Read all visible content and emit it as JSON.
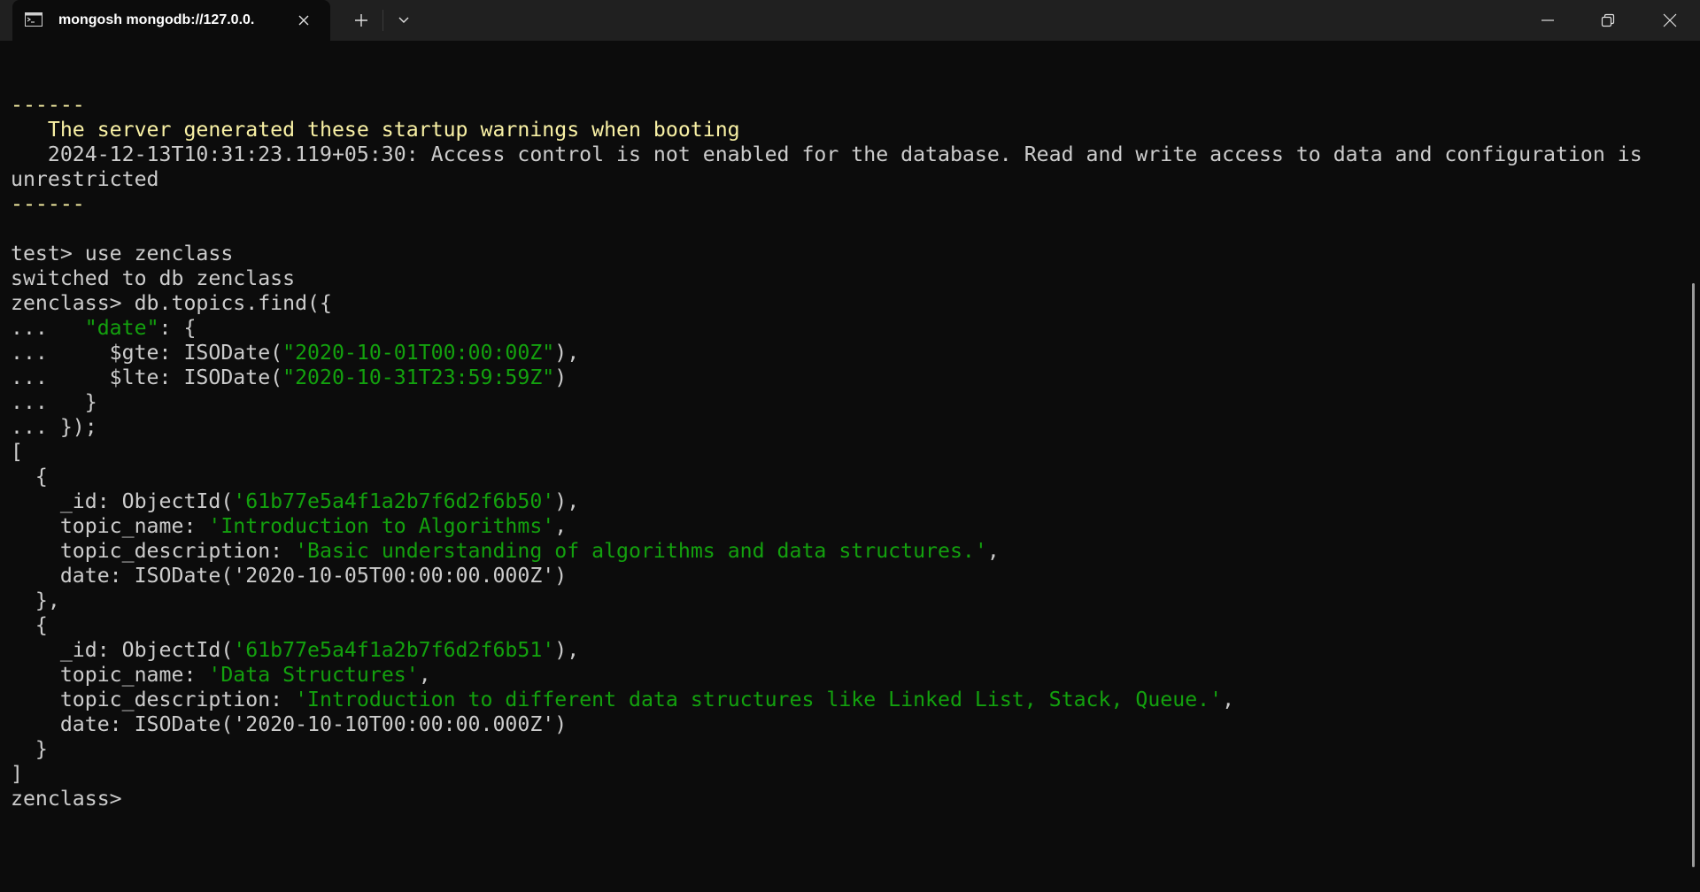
{
  "tab": {
    "title": "mongosh mongodb://127.0.0.",
    "icon": "terminal-icon",
    "close_icon": "close-icon"
  },
  "toolbar": {
    "new_tab_icon": "plus-icon",
    "dropdown_icon": "chevron-down-icon"
  },
  "window_controls": {
    "minimize_icon": "minimize-icon",
    "maximize_icon": "restore-icon",
    "close_icon": "close-icon"
  },
  "colors": {
    "background": "#0c0c0c",
    "titlebar": "#202020",
    "text": "#cccccc",
    "warning": "#f9f1a5",
    "string": "#13a10e"
  },
  "terminal": {
    "lines": [
      [],
      [
        {
          "t": "------",
          "c": "yellow"
        }
      ],
      [
        {
          "t": "   The server generated these startup warnings when booting",
          "c": "yellow"
        }
      ],
      [
        {
          "t": "   2024-12-13T10:31:23.119+05:30: Access control is not enabled for the database. Read and write access to data and configuration is",
          "c": "def"
        }
      ],
      [
        {
          "t": "unrestricted",
          "c": "def"
        }
      ],
      [
        {
          "t": "------",
          "c": "yellow"
        }
      ],
      [],
      [
        {
          "t": "test> use zenclass",
          "c": "def"
        }
      ],
      [
        {
          "t": "switched to db zenclass",
          "c": "def"
        }
      ],
      [
        {
          "t": "zenclass> db.topics.find({",
          "c": "def"
        }
      ],
      [
        {
          "t": "...   ",
          "c": "def"
        },
        {
          "t": "\"date\"",
          "c": "green"
        },
        {
          "t": ": {",
          "c": "def"
        }
      ],
      [
        {
          "t": "...     $gte: ISODate(",
          "c": "def"
        },
        {
          "t": "\"2020-10-01T00:00:00Z\"",
          "c": "green"
        },
        {
          "t": "),",
          "c": "def"
        }
      ],
      [
        {
          "t": "...     $lte: ISODate(",
          "c": "def"
        },
        {
          "t": "\"2020-10-31T23:59:59Z\"",
          "c": "green"
        },
        {
          "t": ")",
          "c": "def"
        }
      ],
      [
        {
          "t": "...   }",
          "c": "def"
        }
      ],
      [
        {
          "t": "... });",
          "c": "def"
        }
      ],
      [
        {
          "t": "[",
          "c": "def"
        }
      ],
      [
        {
          "t": "  {",
          "c": "def"
        }
      ],
      [
        {
          "t": "    _id: ObjectId(",
          "c": "def"
        },
        {
          "t": "'61b77e5a4f1a2b7f6d2f6b50'",
          "c": "green"
        },
        {
          "t": "),",
          "c": "def"
        }
      ],
      [
        {
          "t": "    topic_name: ",
          "c": "def"
        },
        {
          "t": "'Introduction to Algorithms'",
          "c": "green"
        },
        {
          "t": ",",
          "c": "def"
        }
      ],
      [
        {
          "t": "    topic_description: ",
          "c": "def"
        },
        {
          "t": "'Basic understanding of algorithms and data structures.'",
          "c": "green"
        },
        {
          "t": ",",
          "c": "def"
        }
      ],
      [
        {
          "t": "    date: ISODate('2020-10-05T00:00:00.000Z')",
          "c": "def"
        }
      ],
      [
        {
          "t": "  },",
          "c": "def"
        }
      ],
      [
        {
          "t": "  {",
          "c": "def"
        }
      ],
      [
        {
          "t": "    _id: ObjectId(",
          "c": "def"
        },
        {
          "t": "'61b77e5a4f1a2b7f6d2f6b51'",
          "c": "green"
        },
        {
          "t": "),",
          "c": "def"
        }
      ],
      [
        {
          "t": "    topic_name: ",
          "c": "def"
        },
        {
          "t": "'Data Structures'",
          "c": "green"
        },
        {
          "t": ",",
          "c": "def"
        }
      ],
      [
        {
          "t": "    topic_description: ",
          "c": "def"
        },
        {
          "t": "'Introduction to different data structures like Linked List, Stack, Queue.'",
          "c": "green"
        },
        {
          "t": ",",
          "c": "def"
        }
      ],
      [
        {
          "t": "    date: ISODate('2020-10-10T00:00:00.000Z')",
          "c": "def"
        }
      ],
      [
        {
          "t": "  }",
          "c": "def"
        }
      ],
      [
        {
          "t": "]",
          "c": "def"
        }
      ],
      [
        {
          "t": "zenclass> ",
          "c": "def"
        }
      ]
    ]
  }
}
